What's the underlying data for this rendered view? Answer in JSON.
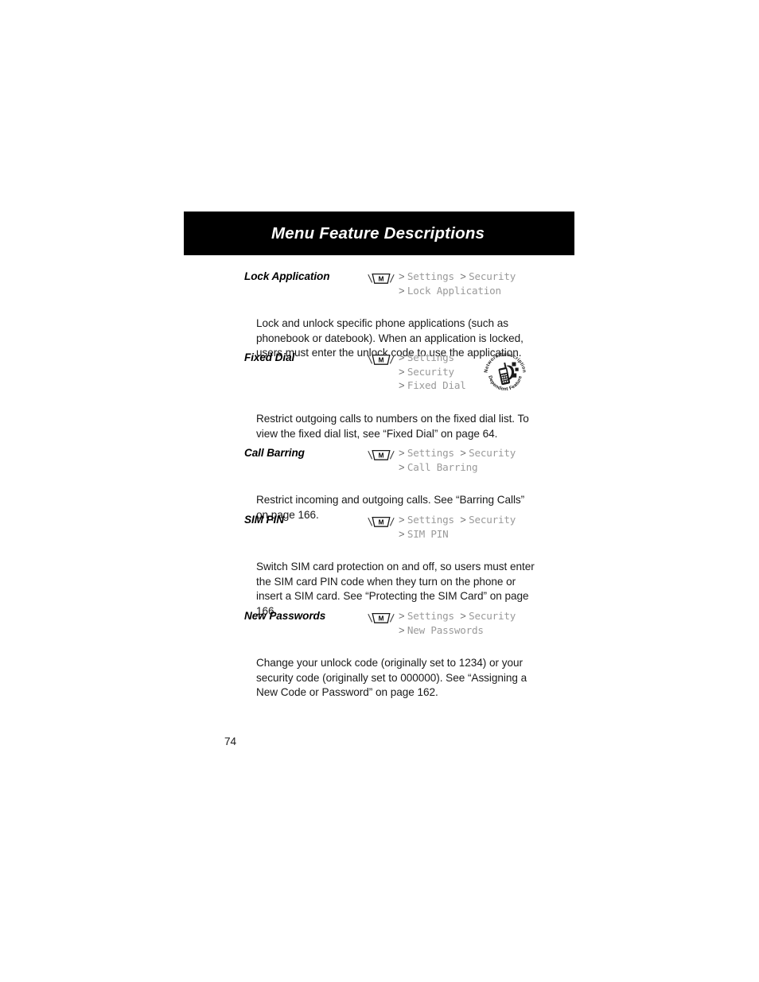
{
  "header": {
    "title": "Menu Feature Descriptions"
  },
  "icons": {
    "menu_key": "menu-key-icon",
    "menu_key_letter": "M",
    "network_badge": "network-subscription-dependent-feature-icon",
    "network_badge_top_text": "Network/Subscription",
    "network_badge_bottom_text": "Dependent Feature"
  },
  "colors": {
    "header_background": "#000000",
    "header_text": "#ffffff",
    "menu_path_text": "#9a9a9a",
    "menu_path_arrow": "#6e6e6e",
    "body_text": "#1a1a1a"
  },
  "entries": [
    {
      "title": "Lock Application",
      "path_lines": [
        [
          "Settings",
          "Security"
        ],
        [
          "Lock Application"
        ]
      ],
      "body": "Lock and unlock specific phone applications (such as phonebook or datebook). When an application is locked, users must enter the unlock code to use the application.",
      "has_network_badge": false
    },
    {
      "title": "Fixed Dial",
      "path_lines": [
        [
          "Settings"
        ],
        [
          "Security"
        ],
        [
          "Fixed Dial"
        ]
      ],
      "body": "Restrict outgoing calls to numbers on the fixed dial list. To view the fixed dial list, see “Fixed Dial” on page 64.",
      "has_network_badge": true
    },
    {
      "title": "Call Barring",
      "path_lines": [
        [
          "Settings",
          "Security"
        ],
        [
          "Call Barring"
        ]
      ],
      "body": "Restrict incoming and outgoing calls. See “Barring Calls” on page 166.",
      "has_network_badge": false
    },
    {
      "title": "SIM PIN",
      "path_lines": [
        [
          "Settings",
          "Security"
        ],
        [
          "SIM PIN"
        ]
      ],
      "body": "Switch SIM card protection on and off, so users must enter the SIM card PIN code when they turn on the phone or insert a SIM card. See “Protecting the SIM Card” on page 166.",
      "has_network_badge": false
    },
    {
      "title": "New Passwords",
      "path_lines": [
        [
          "Settings",
          "Security"
        ],
        [
          "New Passwords"
        ]
      ],
      "body": "Change your unlock code (originally set to 1234) or your security code (originally set to 000000). See “Assigning a New Code or Password” on page 162.",
      "has_network_badge": false
    }
  ],
  "footer": {
    "page_number": "74"
  }
}
